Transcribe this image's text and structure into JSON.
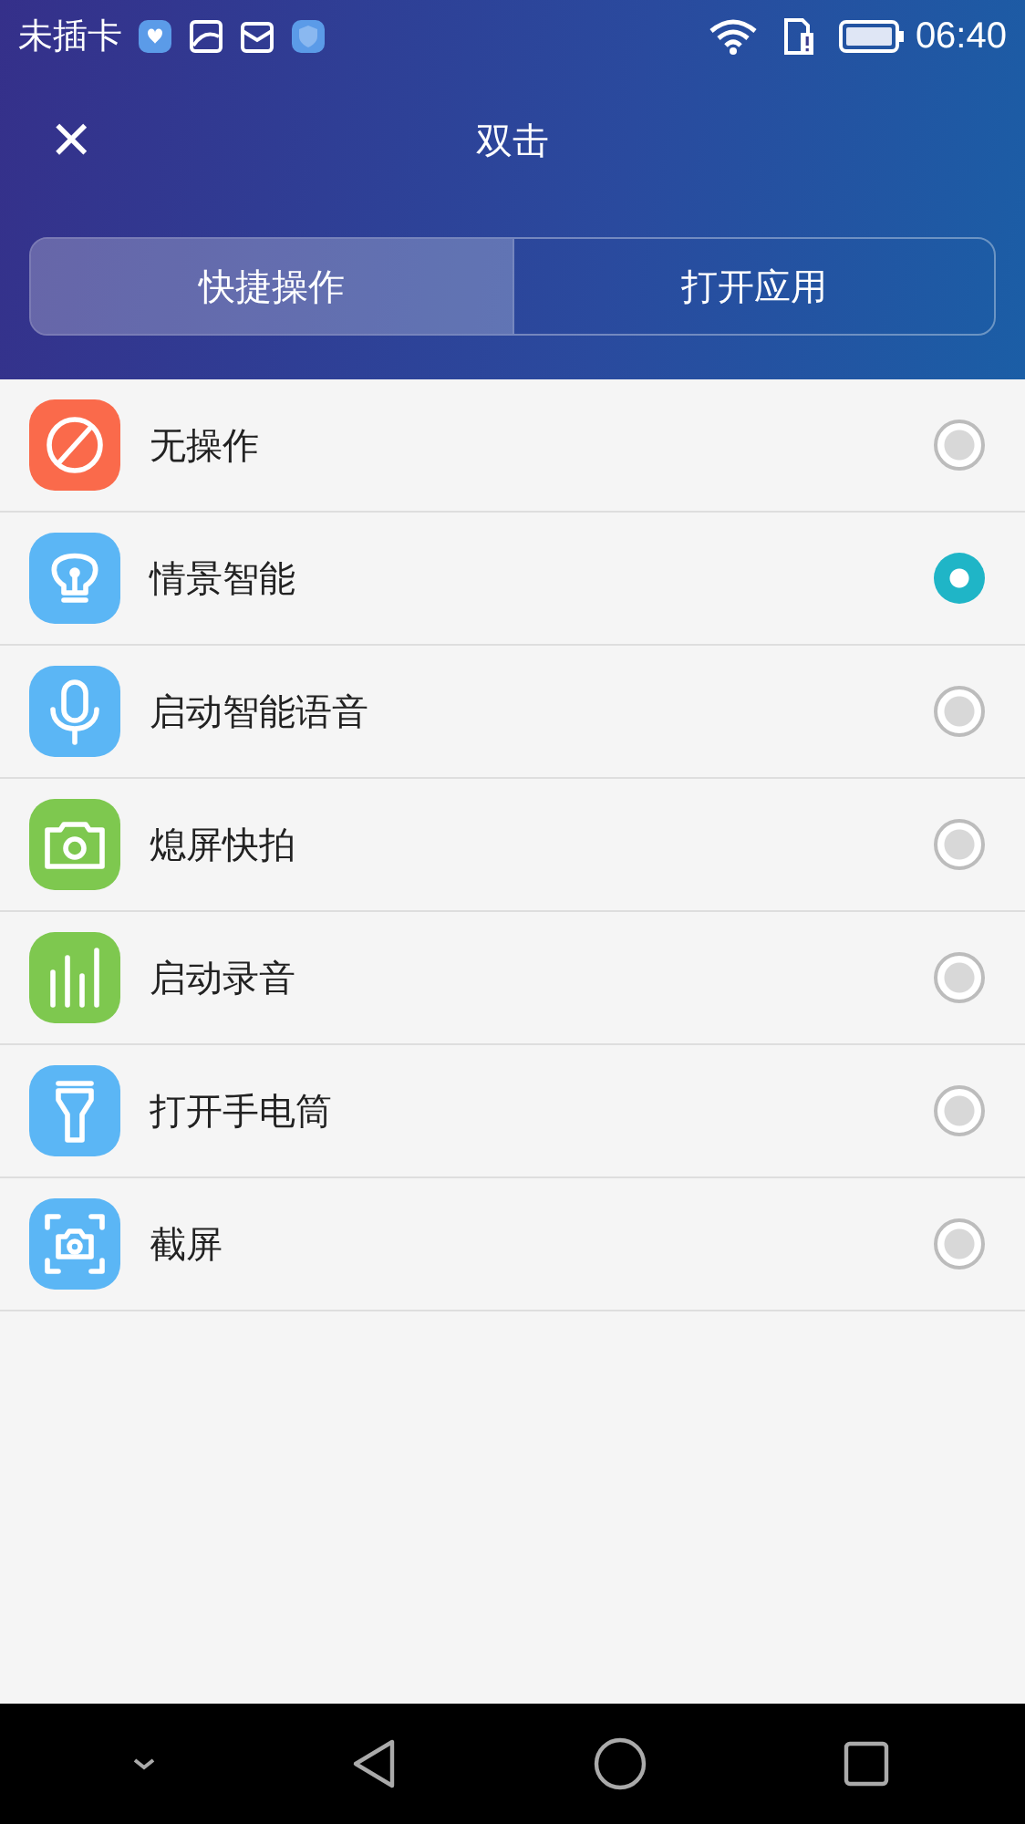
{
  "status_bar": {
    "carrier": "未插卡",
    "time": "06:40"
  },
  "header": {
    "title": "双击",
    "close_icon": "×"
  },
  "tabs": [
    {
      "label": "快捷操作",
      "selected": true
    },
    {
      "label": "打开应用",
      "selected": false
    }
  ],
  "options": [
    {
      "label": "无操作",
      "kind": "blocked",
      "color": "#fa6a4b",
      "selected": false
    },
    {
      "label": "情景智能",
      "kind": "bulb",
      "color": "#5bb6f5",
      "selected": true
    },
    {
      "label": "启动智能语音",
      "kind": "mic",
      "color": "#5bb6f5",
      "selected": false
    },
    {
      "label": "熄屏快拍",
      "kind": "camera",
      "color": "#7ec84f",
      "selected": false
    },
    {
      "label": "启动录音",
      "kind": "bars",
      "color": "#7ec84f",
      "selected": false
    },
    {
      "label": "打开手电筒",
      "kind": "flashlight",
      "color": "#5bb6f5",
      "selected": false
    },
    {
      "label": "截屏",
      "kind": "screenshot",
      "color": "#5bb6f5",
      "selected": false
    }
  ]
}
